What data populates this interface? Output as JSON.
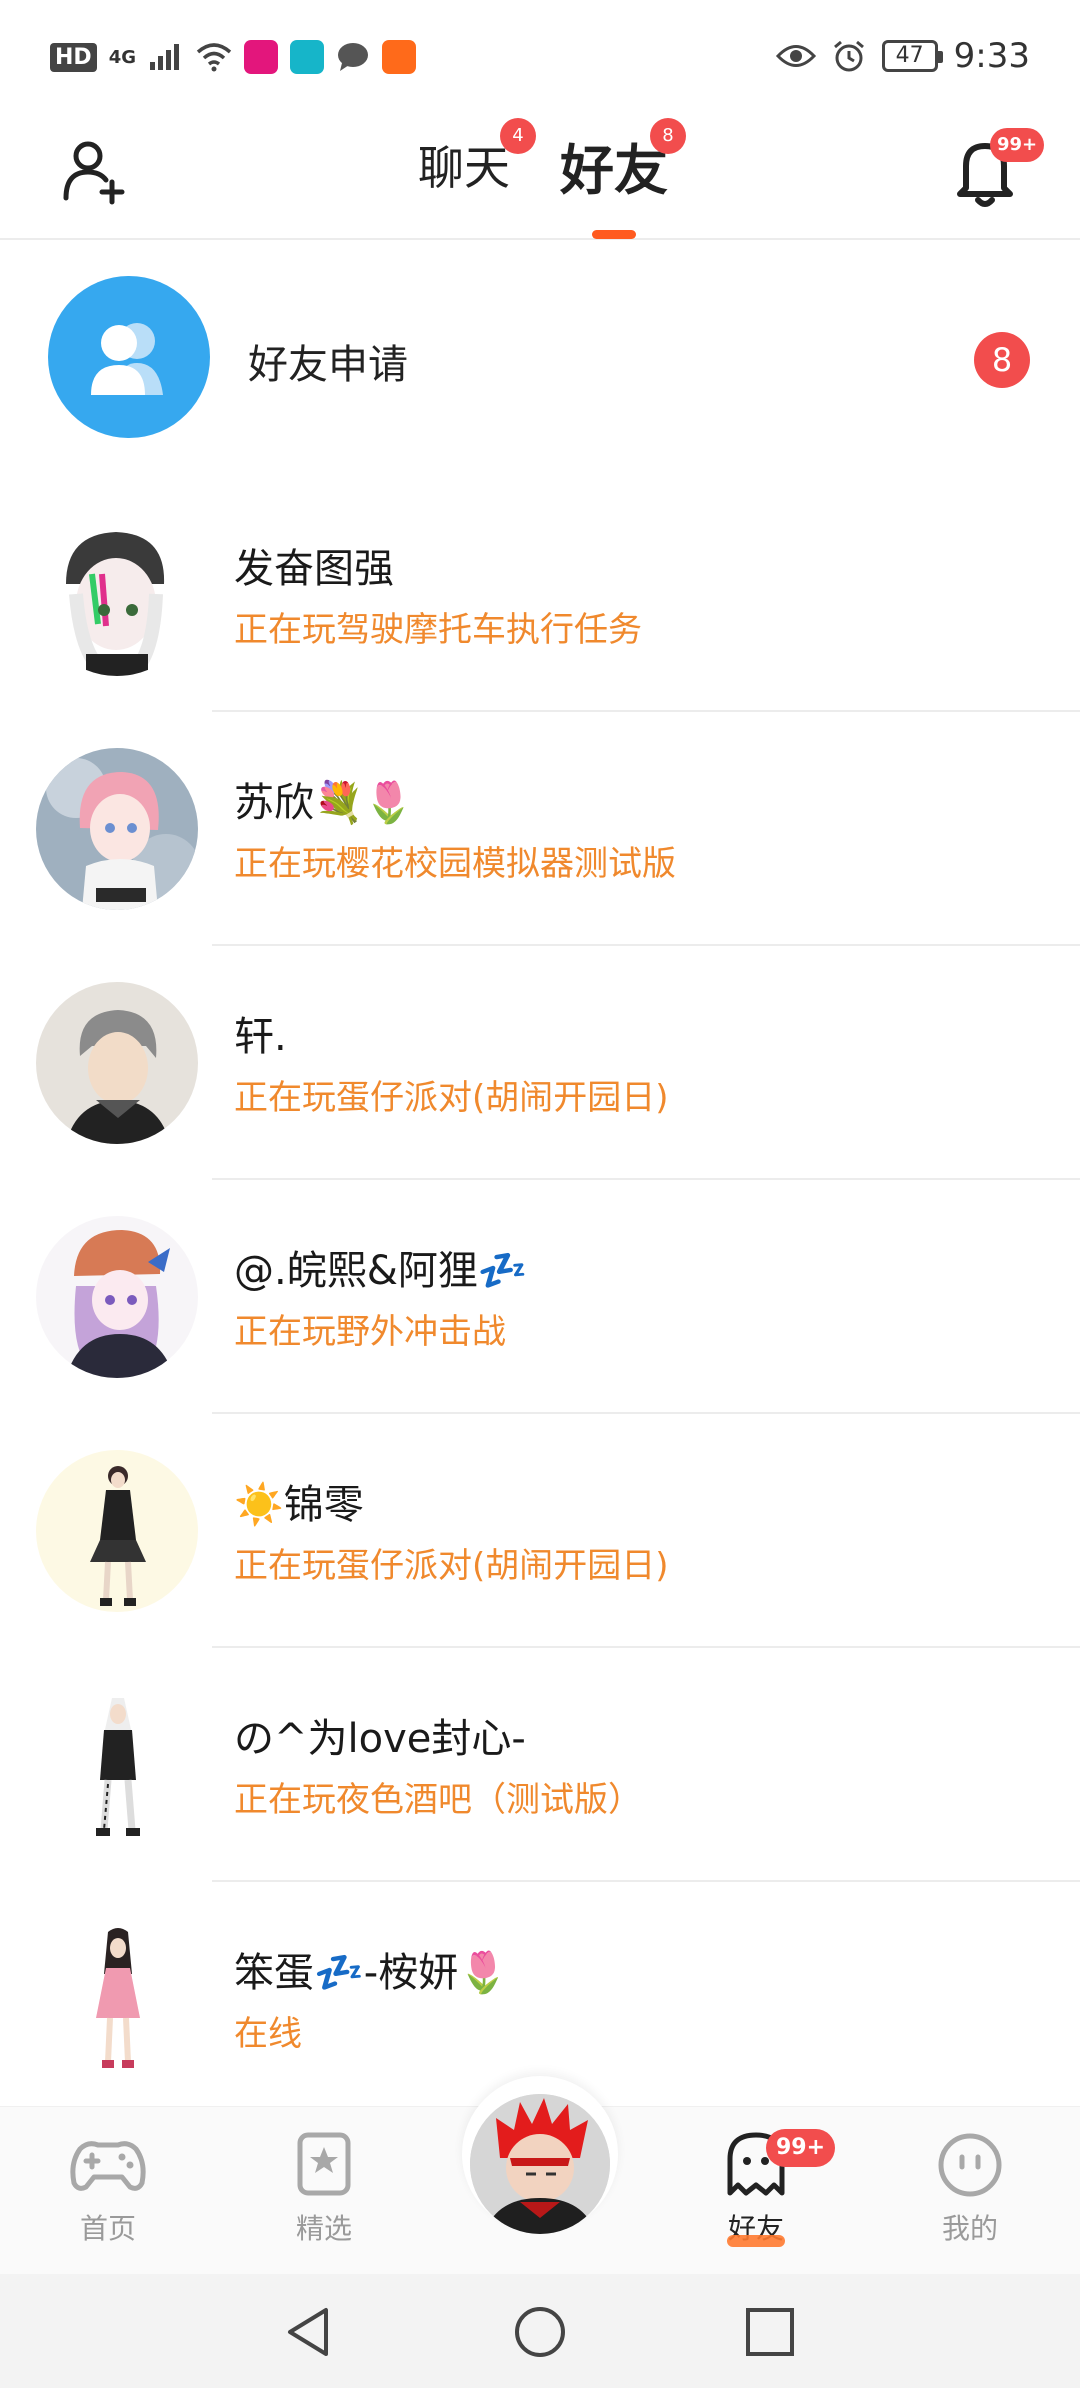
{
  "status_bar": {
    "hd": "HD",
    "network": "4G",
    "battery": "47",
    "time": "9:33"
  },
  "header": {
    "tabs": [
      {
        "label": "聊天",
        "badge": "4"
      },
      {
        "label": "好友",
        "badge": "8"
      }
    ],
    "notification_badge": "99+"
  },
  "friend_request": {
    "label": "好友申请",
    "badge": "8"
  },
  "friends": [
    {
      "name": "发奋图强",
      "status": "正在玩驾驶摩托车执行任务"
    },
    {
      "name": "苏欣💐🌷",
      "status": "正在玩樱花校园模拟器测试版"
    },
    {
      "name": "轩.",
      "status": "正在玩蛋仔派对(胡闹开园日)"
    },
    {
      "name": "@.皖熙&阿狸💤",
      "status": "正在玩野外冲击战"
    },
    {
      "name": "☀️锦零",
      "status": "正在玩蛋仔派对(胡闹开园日)"
    },
    {
      "name": "の^为love封心-",
      "status": "正在玩夜色酒吧（测试版）"
    },
    {
      "name": "笨蛋💤-桉妍🌷",
      "status": "在线"
    }
  ],
  "bottom_nav": {
    "items": [
      {
        "label": "首页",
        "icon": "gamepad-icon"
      },
      {
        "label": "精选",
        "icon": "star-card-icon"
      },
      {
        "label": "好友",
        "icon": "ghost-icon",
        "badge": "99+"
      },
      {
        "label": "我的",
        "icon": "smiley-icon"
      }
    ]
  },
  "colors": {
    "accent": "#ff5a1f",
    "status_text": "#f0892d",
    "badge": "#f24d4d",
    "request_avatar": "#36a8ef"
  }
}
